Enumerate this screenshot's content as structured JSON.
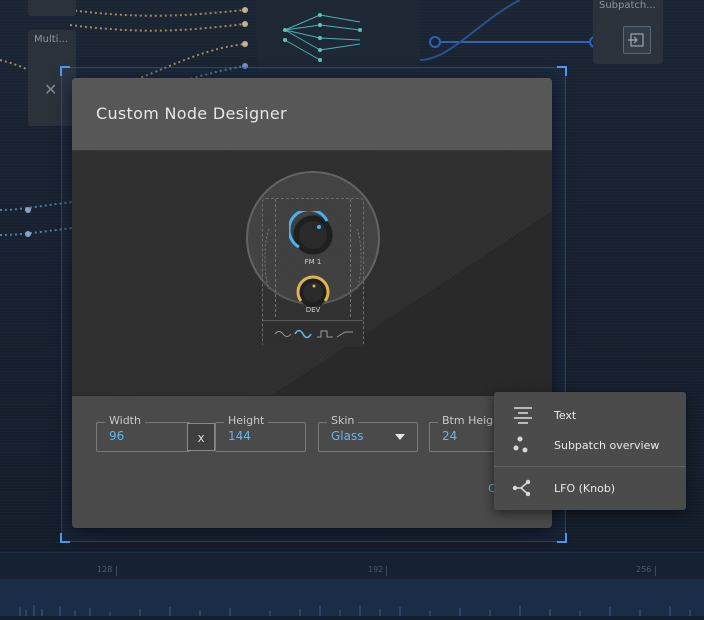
{
  "background": {
    "nodes": [
      {
        "label": "Multi..."
      },
      {
        "label": "Subpatch..."
      }
    ],
    "timeline": {
      "markers": [
        "128",
        "192",
        "256"
      ]
    }
  },
  "dialog": {
    "title": "Custom Node Designer",
    "preview": {
      "knob1_label": "FM 1",
      "knob2_label": "DEV",
      "waveforms": [
        "sine",
        "triangle",
        "square",
        "saw"
      ],
      "selected_waveform": "triangle"
    },
    "fields": {
      "width": {
        "label": "Width",
        "value": "96"
      },
      "separator": "x",
      "height": {
        "label": "Height",
        "value": "144"
      },
      "skin": {
        "label": "Skin",
        "value": "Glass"
      },
      "btm_height": {
        "label": "Btm Heigh",
        "value": "24"
      }
    },
    "cancel_peek": "C"
  },
  "context_menu": {
    "items": [
      {
        "label": "Text",
        "icon": "text-align-icon"
      },
      {
        "label": "Subpatch overview",
        "icon": "subpatch-dots-icon"
      },
      {
        "label": "LFO (Knob)",
        "icon": "branch-icon"
      }
    ]
  },
  "colors": {
    "accent": "#5fb8ee",
    "knob_ring_blue": "#47b3ee",
    "knob_ring_gold": "#e0b44c"
  }
}
